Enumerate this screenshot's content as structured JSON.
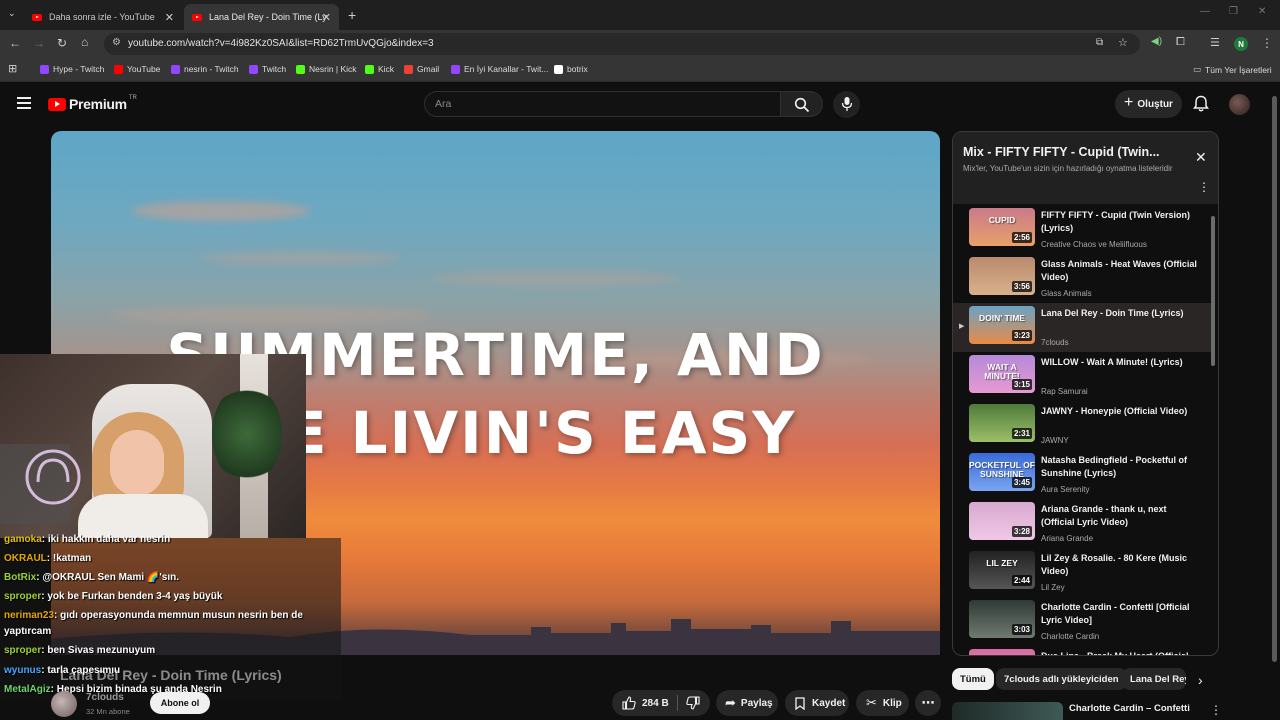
{
  "browser": {
    "tabs": [
      {
        "title": "Daha sonra izle - YouTube"
      },
      {
        "title": "Lana Del Rey - Doin Time (Lyric"
      }
    ],
    "new_tab": "+",
    "url": "youtube.com/watch?v=4i982Kz0SAI&list=RD62TrmUvQGjo&index=3",
    "profile_initial": "N",
    "bookmarks": [
      {
        "label": "Hype - Twitch",
        "color": "#9146ff"
      },
      {
        "label": "YouTube",
        "color": "#ff0000"
      },
      {
        "label": "nesrin - Twitch",
        "color": "#9146ff"
      },
      {
        "label": "Twitch",
        "color": "#9146ff"
      },
      {
        "label": "Nesrin | Kick",
        "color": "#53fc18"
      },
      {
        "label": "Kick",
        "color": "#53fc18"
      },
      {
        "label": "Gmail",
        "color": "#ea4335"
      },
      {
        "label": "En İyi Kanallar - Twit...",
        "color": "#9146ff"
      },
      {
        "label": "botrix",
        "color": "#ffffff"
      }
    ],
    "all_bookmarks": "Tüm Yer İşaretleri"
  },
  "youtube": {
    "logo_text": "Premium",
    "country": "TR",
    "search_placeholder": "Ara",
    "create_label": "Oluştur"
  },
  "video": {
    "lyric_line1": "SUMMERTIME, AND",
    "lyric_line2": "THE LIVIN'S EASY",
    "title": "Lana Del Rey - Doin Time (Lyrics)",
    "channel": "7clouds",
    "subscribers": "32 Mn abone",
    "subscribe_label": "Abone ol",
    "likes": "284 B",
    "share_label": "Paylaş",
    "save_label": "Kaydet",
    "clip_label": "Klip"
  },
  "chat": [
    {
      "user": "gamoka",
      "text": ": iki hakkın daha var nesrin",
      "color": "#e6c200"
    },
    {
      "user": "OKRAUL",
      "text": ": !katman",
      "color": "#e6a700"
    },
    {
      "user": "BotRix",
      "text": ": @OKRAUL Sen Mami 🌈'sın.",
      "color": "#9bd13a"
    },
    {
      "user": "sproper",
      "text": ": yok be Furkan benden 3-4 yaş büyük",
      "color": "#9bd13a"
    },
    {
      "user": "neriman23",
      "text": ": gıdı operasyonunda memnun musun nesrin ben de",
      "color": "#e6a700"
    },
    {
      "user": "",
      "text": "yaptırcam",
      "color": "#ffffff"
    },
    {
      "user": "sproper",
      "text": ": ben Sivas mezunuyum",
      "color": "#9bd13a"
    },
    {
      "user": "wyunus",
      "text": ": tarla çapesımıu",
      "color": "#4aa3ff"
    },
    {
      "user": "MetalAgiz",
      "text": ": Hepsi bizim binada şu anda Nesrin",
      "color": "#6ad46a"
    }
  ],
  "playlist": {
    "title": "Mix - FIFTY FIFTY - Cupid (Twin...",
    "subtitle": "Mix'ler, YouTube'un sizin için hazırladığı oynatma listeleridir",
    "items": [
      {
        "title": "FIFTY FIFTY - Cupid (Twin Version) (Lyrics)",
        "channel": "Creative Chaos ve Meliifluous",
        "duration": "2:56",
        "thumb_text": "CUPID",
        "c1": "#c97a8a",
        "c2": "#e8a16a"
      },
      {
        "title": "Glass Animals - Heat Waves (Official Video)",
        "channel": "Glass Animals",
        "duration": "3:56",
        "thumb_text": "",
        "c1": "#b98a6c",
        "c2": "#d9b08c"
      },
      {
        "title": "Lana Del Rey - Doin Time (Lyrics)",
        "channel": "7clouds",
        "duration": "3:23",
        "thumb_text": "DOIN' TIME",
        "c1": "#6aa3c6",
        "c2": "#ea8a45"
      },
      {
        "title": "WILLOW - Wait A Minute! (Lyrics)",
        "channel": "Rap Samurai",
        "duration": "3:15",
        "thumb_text": "WAIT A MINUTE!",
        "c1": "#b58ad8",
        "c2": "#e69ad0"
      },
      {
        "title": "JAWNY - Honeypie (Official Video)",
        "channel": "JAWNY",
        "duration": "2:31",
        "thumb_text": "",
        "c1": "#4f7a3a",
        "c2": "#9bbf6a"
      },
      {
        "title": "Natasha Bedingfield - Pocketful of Sunshine (Lyrics)",
        "channel": "Aura Serenity",
        "duration": "3:45",
        "thumb_text": "POCKETFUL OF SUNSHINE",
        "c1": "#3a6ad8",
        "c2": "#7aa5f0"
      },
      {
        "title": "Ariana Grande - thank u, next (Official Lyric Video)",
        "channel": "Ariana Grande",
        "duration": "3:28",
        "thumb_text": "",
        "c1": "#d8a8d0",
        "c2": "#f0c8e6"
      },
      {
        "title": "Lil Zey & Rosalie. - 80 Kere (Music Video)",
        "channel": "Lil Zey",
        "duration": "2:44",
        "thumb_text": "LIL ZEY",
        "c1": "#222222",
        "c2": "#555555"
      },
      {
        "title": "Charlotte Cardin - Confetti [Official Lyric Video]",
        "channel": "Charlotte Cardin",
        "duration": "3:03",
        "thumb_text": "",
        "c1": "#2f3a36",
        "c2": "#6f7a70"
      },
      {
        "title": "Dua Lipa - Break My Heart (Official Video)",
        "channel": "",
        "duration": "",
        "thumb_text": "",
        "c1": "#d86aa0",
        "c2": "#f0a0c8"
      }
    ]
  },
  "chips": [
    "Tümü",
    "7clouds adlı yükleyiciden",
    "Lana Del Rey"
  ],
  "next_video_title": "Charlotte Cardin – Confetti"
}
